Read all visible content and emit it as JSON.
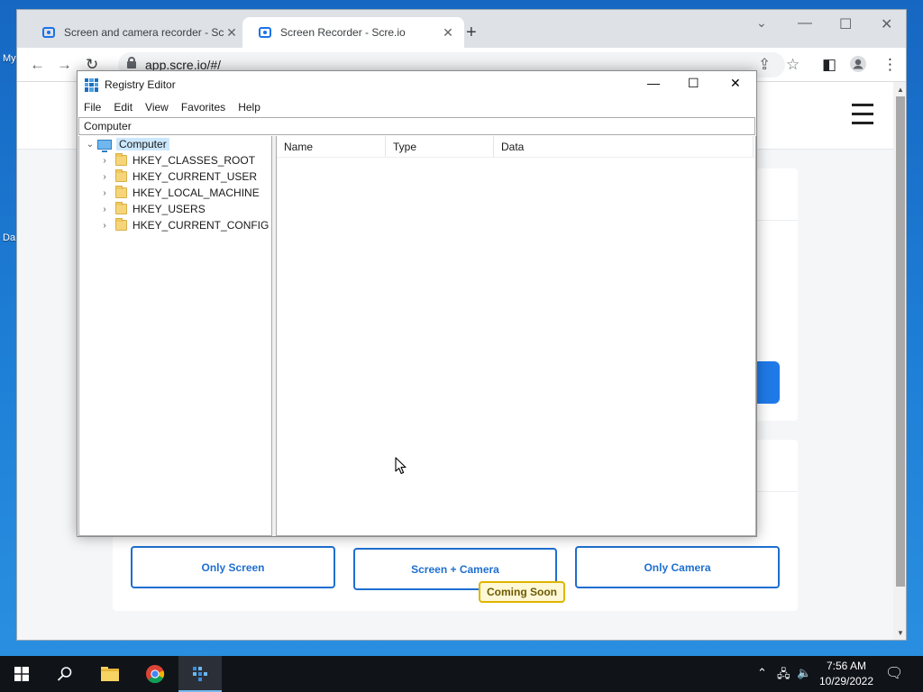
{
  "desktop": {
    "icon_labels": [
      "My",
      "Da"
    ]
  },
  "browser": {
    "tabs": [
      {
        "title": "Screen and camera recorder - Scre.io",
        "close": "✕"
      },
      {
        "title": "Screen Recorder - Scre.io",
        "close": "✕"
      }
    ],
    "new_tab": "+",
    "address": "app.scre.io/#/",
    "window_controls": {
      "tab_search": "⌄",
      "minimize": "—",
      "maximize": "☐",
      "close": "✕"
    }
  },
  "site": {
    "options": [
      {
        "label": "Only Screen"
      },
      {
        "label": "Screen + Camera"
      },
      {
        "label": "Only Camera"
      }
    ],
    "coming_soon": "Coming Soon"
  },
  "regedit": {
    "title": "Registry Editor",
    "menu": [
      "File",
      "Edit",
      "View",
      "Favorites",
      "Help"
    ],
    "address": "Computer",
    "tree_root": "Computer",
    "tree_items": [
      "HKEY_CLASSES_ROOT",
      "HKEY_CURRENT_USER",
      "HKEY_LOCAL_MACHINE",
      "HKEY_USERS",
      "HKEY_CURRENT_CONFIG"
    ],
    "columns": [
      "Name",
      "Type",
      "Data"
    ],
    "controls": {
      "minimize": "—",
      "maximize": "☐",
      "close": "✕"
    }
  },
  "taskbar": {
    "time": "7:56 AM",
    "date": "10/29/2022"
  },
  "colors": {
    "accent": "#1e6fd0",
    "taskbar": "#101318",
    "coming_soon_border": "#e0b400"
  }
}
